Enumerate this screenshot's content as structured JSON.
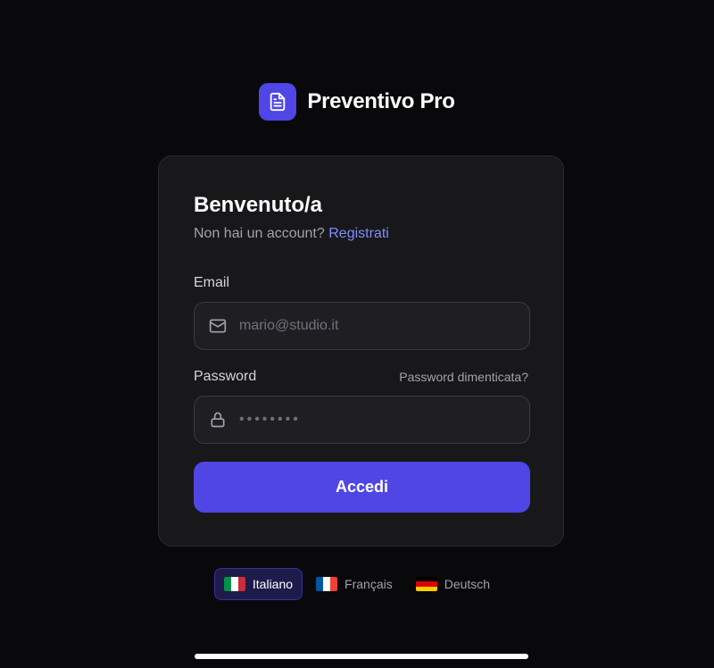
{
  "brand": {
    "name": "Preventivo Pro",
    "logo_icon": "document-icon"
  },
  "login": {
    "title": "Benvenuto/a",
    "subtitle_prefix": "Non hai un account?",
    "register_label": "Registrati",
    "email_label": "Email",
    "email_placeholder": "mario@studio.it",
    "email_icon": "mail-icon",
    "password_label": "Password",
    "forgot_label": "Password dimenticata?",
    "password_placeholder": "••••••••",
    "password_icon": "lock-icon",
    "submit_label": "Accedi"
  },
  "languages": [
    {
      "label": "Italiano",
      "active": true
    },
    {
      "label": "Français",
      "active": false
    },
    {
      "label": "Deutsch",
      "active": false
    }
  ],
  "colors": {
    "background": "#09090b",
    "card": "#18181b",
    "accent": "#4f46e5",
    "link": "#818cf8"
  }
}
